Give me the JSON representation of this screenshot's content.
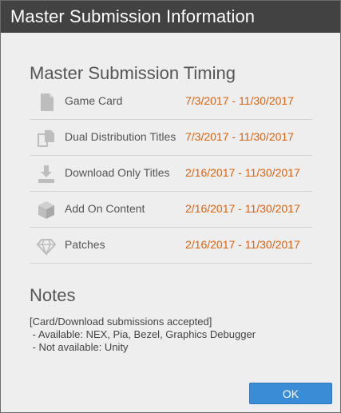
{
  "dialog": {
    "title": "Master Submission Information",
    "timing_heading": "Master Submission Timing",
    "timing_rows": [
      {
        "label": "Game Card",
        "dates": "7/3/2017 - 11/30/2017",
        "icon": "game-card-icon"
      },
      {
        "label": "Dual Distribution Titles",
        "dates": "7/3/2017 - 11/30/2017",
        "icon": "dual-distribution-icon"
      },
      {
        "label": "Download Only Titles",
        "dates": "2/16/2017 - 11/30/2017",
        "icon": "download-icon"
      },
      {
        "label": "Add On Content",
        "dates": "2/16/2017 - 11/30/2017",
        "icon": "add-on-content-box-icon"
      },
      {
        "label": "Patches",
        "dates": "2/16/2017 - 11/30/2017",
        "icon": "patch-diamond-icon"
      }
    ],
    "notes_heading": "Notes",
    "notes_lines": [
      "[Card/Download submissions accepted]",
      " - Available: NEX, Pia, Bezel, Graphics Debugger",
      " - Not available: Unity"
    ],
    "ok_label": "OK"
  },
  "colors": {
    "titlebar": "#424242",
    "background": "#efeeef",
    "date_accent": "#d9620c",
    "button": "#3b8cd6",
    "icon": "#bdbdbd"
  }
}
